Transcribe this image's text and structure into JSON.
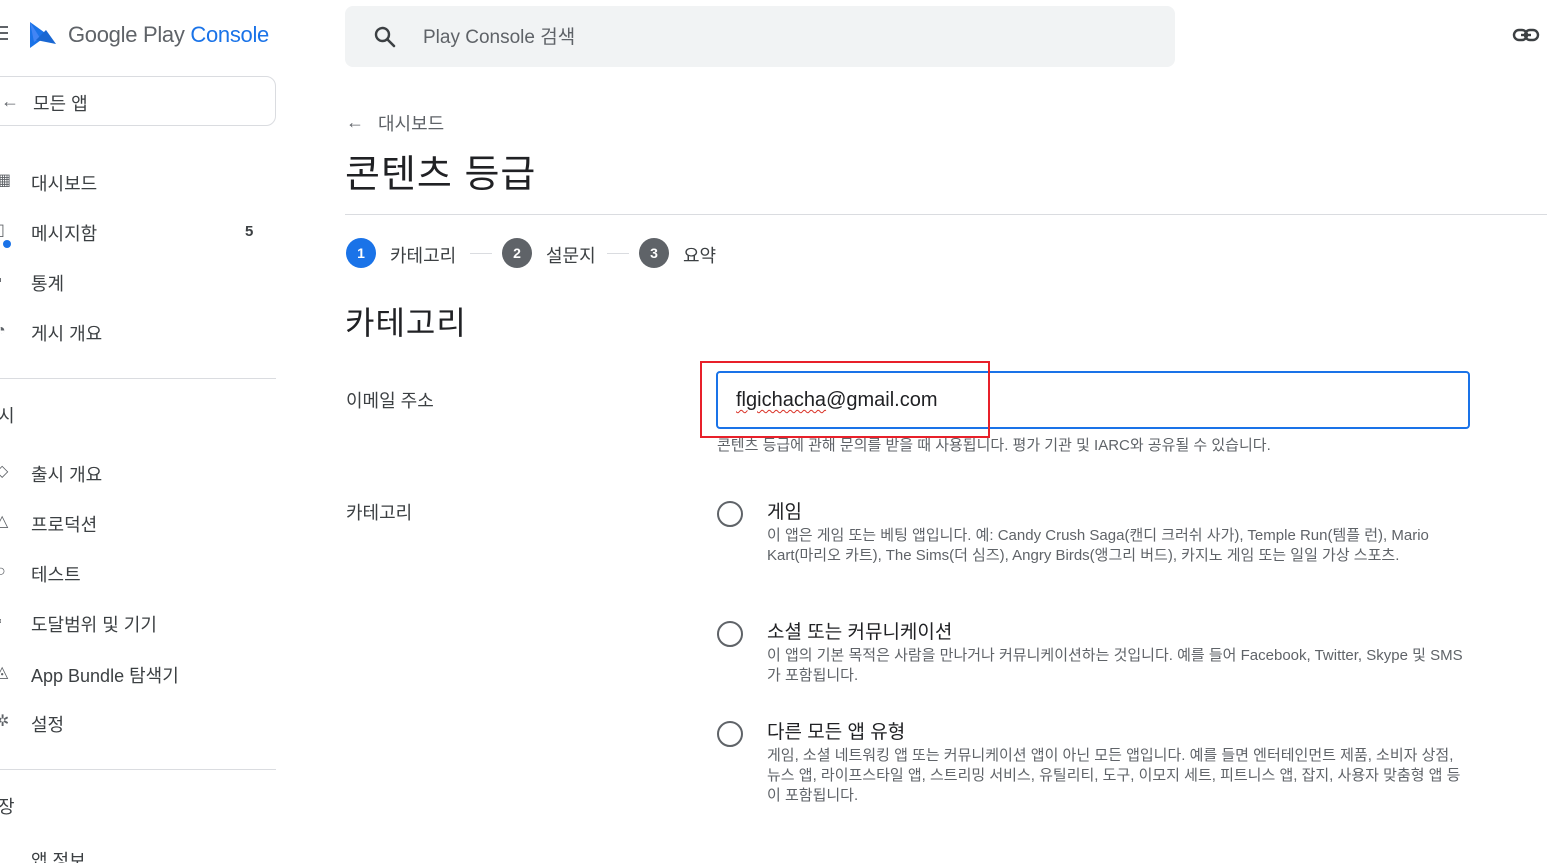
{
  "app": {
    "logo_google_play": "Google Play",
    "logo_console": "Console"
  },
  "search": {
    "placeholder": "Play Console 검색"
  },
  "sidebar": {
    "all_apps_label": "모든 앱",
    "items_top": [
      {
        "label": "대시보드"
      },
      {
        "label": "메시지함",
        "count": "5"
      },
      {
        "label": "통계"
      },
      {
        "label": "게시 개요"
      }
    ],
    "section_release": "시",
    "items_release": [
      {
        "label": "출시 개요"
      },
      {
        "label": "프로덕션"
      },
      {
        "label": "테스트"
      },
      {
        "label": "도달범위 및 기기"
      },
      {
        "label": "App Bundle 탐색기"
      },
      {
        "label": "설정"
      }
    ],
    "section_store": "장",
    "item_partial": "앱 정보"
  },
  "main": {
    "back_label": "대시보드",
    "page_title": "콘텐츠 등급",
    "steps": [
      {
        "num": "1",
        "label": "카테고리",
        "active": true
      },
      {
        "num": "2",
        "label": "설문지",
        "active": false
      },
      {
        "num": "3",
        "label": "요약",
        "active": false
      }
    ],
    "section_heading": "카테고리",
    "email": {
      "label": "이메일 주소",
      "value_misspelled": "flgichacha",
      "value_rest": "@gmail.com",
      "help": "콘텐츠 등급에 관해 문의를 받을 때 사용됩니다. 평가 기관 및 IARC와 공유될 수 있습니다."
    },
    "category": {
      "label": "카테고리",
      "options": [
        {
          "title": "게임",
          "desc": "이 앱은 게임 또는 베팅 앱입니다. 예: Candy Crush Saga(캔디 크러쉬 사가), Temple Run(템플 런), Mario Kart(마리오 카트), The Sims(더 심즈), Angry Birds(앵그리 버드), 카지노 게임 또는 일일 가상 스포츠."
        },
        {
          "title": "소셜 또는 커뮤니케이션",
          "desc": "이 앱의 기본 목적은 사람을 만나거나 커뮤니케이션하는 것입니다. 예를 들어 Facebook, Twitter, Skype 및 SMS가 포함됩니다."
        },
        {
          "title": "다른 모든 앱 유형",
          "desc": "게임, 소셜 네트워킹 앱 또는 커뮤니케이션 앱이 아닌 모든 앱입니다. 예를 들면 엔터테인먼트 제품, 소비자 상점, 뉴스 앱, 라이프스타일 앱, 스트리밍 서비스, 유틸리티, 도구, 이모지 세트, 피트니스 앱, 잡지, 사용자 맞춤형 앱 등이 포함됩니다."
        }
      ]
    }
  },
  "colors": {
    "accent": "#1a73e8",
    "step_inactive": "#5f6368",
    "highlight_box": "#e8202a"
  }
}
